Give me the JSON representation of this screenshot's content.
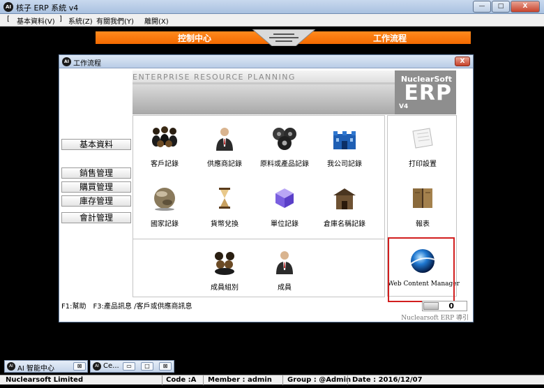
{
  "window": {
    "title": "核子 ERP 系統 v4",
    "logo": "AI",
    "min": "—",
    "max": "□",
    "close": "X"
  },
  "menu": {
    "open_bracket": "[",
    "close_bracket": "]",
    "item1": "基本資料(V)",
    "item2": "系統(Z)",
    "item3": "有關我們(Y)",
    "item4": "離開(X)"
  },
  "header": {
    "left_tab": "控制中心",
    "right_tab": "工作流程"
  },
  "dialog": {
    "title": "工作流程",
    "logo": "AI",
    "close": "X",
    "banner": {
      "tagline": "ENTERPRISE RESOURCE PLANNING",
      "brand": "NuclearSoft",
      "product": "ERP",
      "version": "V4"
    }
  },
  "nav": [
    {
      "label": "基本資料"
    },
    {
      "label": "銷售管理"
    },
    {
      "label": "購買管理"
    },
    {
      "label": "庫存管理"
    },
    {
      "label": "會計管理"
    }
  ],
  "tiles": {
    "customer": "客戶記錄",
    "supplier": "供應商記錄",
    "material": "原料或產品記錄",
    "company": "我公司記錄",
    "country": "國家記錄",
    "currency": "貨幣兌換",
    "unit": "單位記錄",
    "warehouse": "倉庫名稱記錄",
    "member_group": "成員組別",
    "member": "成員",
    "print_settings": "打印設置",
    "report": "報表",
    "web_content": "Web Content Manager"
  },
  "status_hint": "F1:幫助　F3:產品訊息 /客戶或供應商訊息",
  "toggle_value": "0",
  "footer_link": "Nuclearsoft ERP 導引",
  "taskbar": [
    {
      "label": "AI 智能中心",
      "close": "⊠"
    },
    {
      "label": "Ce..."
    }
  ],
  "statusbar": {
    "company": "Nuclearsoft Limited",
    "code": "Code :A",
    "member": "Member :  admin",
    "group": "Group :  @Admin",
    "date": "Date :  2016/12/07"
  },
  "colors": {
    "accent_orange": "#f46a00",
    "highlight_red": "#d21e1e",
    "banner_grey": "#8e8e8e"
  }
}
